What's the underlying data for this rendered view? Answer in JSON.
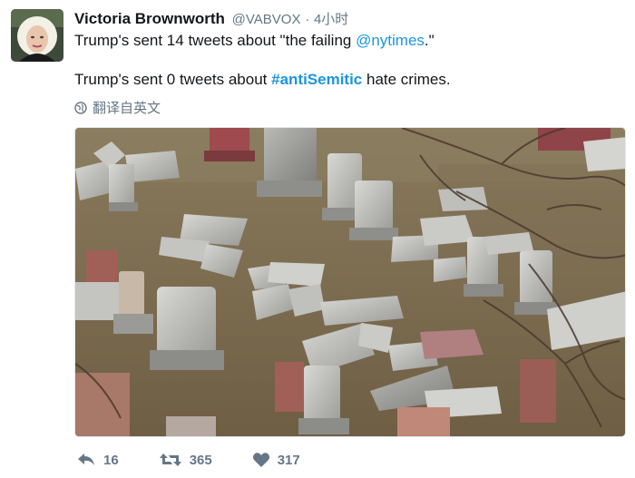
{
  "tweet": {
    "author_name": "Victoria Brownworth",
    "handle": "@VABVOX",
    "separator": "·",
    "time": "4小时",
    "line1_prefix": "Trump's sent 14 tweets about \"the failing ",
    "line1_mention": "@nytimes",
    "line1_suffix": ".\"",
    "line2_prefix": "Trump's sent 0 tweets about ",
    "line2_hashtag": "#antiSemitic",
    "line2_suffix": " hate crimes.",
    "translate_label": "翻译自英文"
  },
  "actions": {
    "reply_count": "16",
    "retweet_count": "365",
    "like_count": "317"
  },
  "colors": {
    "link": "#1b95e0",
    "muted": "#657786",
    "text": "#14171a"
  },
  "icons": [
    "avatar",
    "globe-icon",
    "reply-icon",
    "retweet-icon",
    "heart-icon"
  ]
}
